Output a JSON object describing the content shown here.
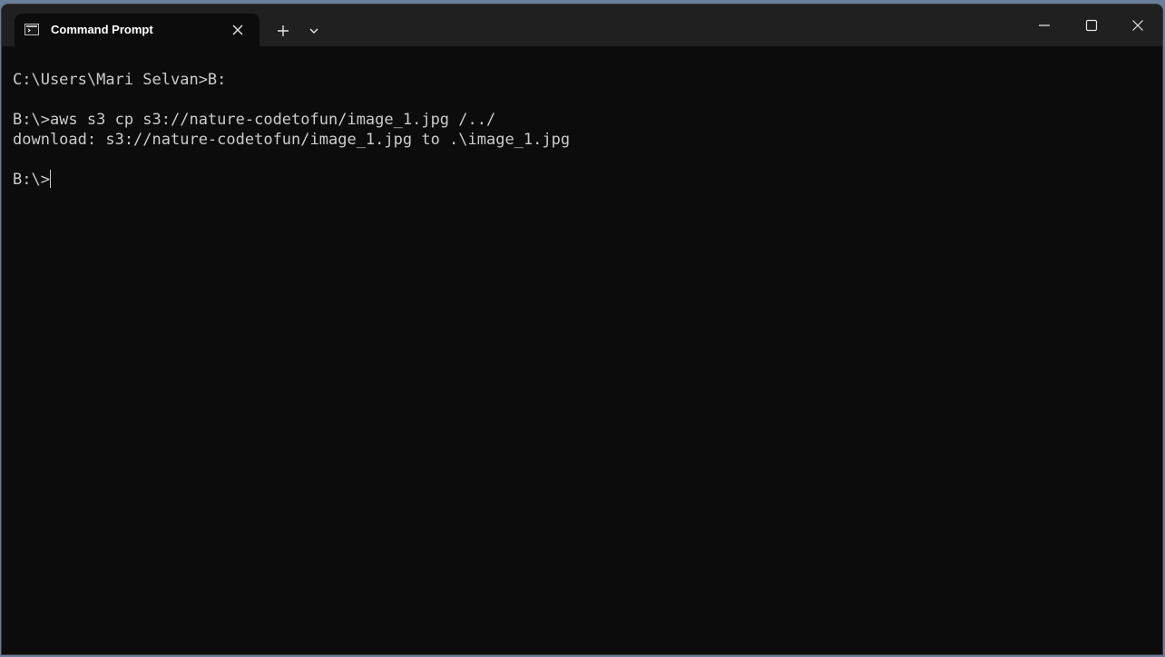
{
  "window": {
    "tab": {
      "title": "Command Prompt",
      "icon": "command-prompt-icon"
    },
    "controls": {
      "new_tab_icon": "plus-icon",
      "dropdown_icon": "chevron-down-icon",
      "minimize_icon": "minimize-icon",
      "maximize_icon": "maximize-icon",
      "close_icon": "close-icon"
    }
  },
  "terminal": {
    "lines": [
      "C:\\Users\\Mari Selvan>B:",
      "",
      "B:\\>aws s3 cp s3://nature-codetofun/image_1.jpg /../",
      "download: s3://nature-codetofun/image_1.jpg to .\\image_1.jpg",
      "",
      "B:\\>"
    ],
    "colors": {
      "background": "#0c0c0c",
      "foreground": "#cccccc"
    }
  }
}
